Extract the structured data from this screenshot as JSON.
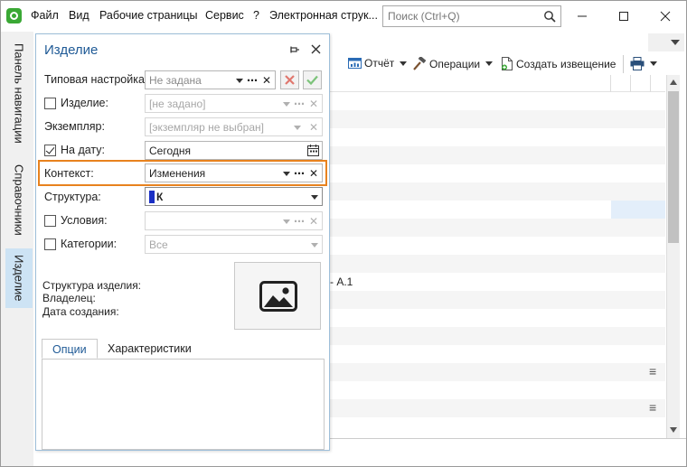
{
  "menu": [
    "Файл",
    "Вид",
    "Рабочие страницы",
    "Сервис",
    "?",
    "Электронная струк..."
  ],
  "search": {
    "placeholder": "Поиск (Ctrl+Q)"
  },
  "window_controls": {
    "minimize": "─",
    "maximize": "☐",
    "close": "✕"
  },
  "left_tabs": [
    {
      "label": "Панель навигации",
      "active": false
    },
    {
      "label": "Справочники",
      "active": false
    },
    {
      "label": "Изделие",
      "active": true
    }
  ],
  "toolbar": {
    "report_label": "Отчёт",
    "operations_label": "Операции",
    "create_notice_label": "Создать извещение"
  },
  "grid": {
    "row_text": "- А.1",
    "menu_glyph": "≡"
  },
  "panel": {
    "title": "Изделие",
    "pin_glyph": "⊸",
    "close_glyph": "✕",
    "fields": {
      "template": {
        "label": "Типовая настройка:",
        "value": "Не задана"
      },
      "product": {
        "label": "Изделие:",
        "value": "[не задано]",
        "checked": false
      },
      "instance": {
        "label": "Экземпляр:",
        "value": "[экземпляр не выбран]"
      },
      "on_date": {
        "label": "На дату:",
        "value": "Сегодня",
        "checked": true
      },
      "context": {
        "label": "Контекст:",
        "value": "Изменения"
      },
      "structure": {
        "label": "Структура:",
        "value": "К"
      },
      "conditions": {
        "label": "Условия:",
        "value": "",
        "checked": false
      },
      "categories": {
        "label": "Категории:",
        "value": "Все",
        "checked": false
      }
    },
    "info": {
      "structure_label": "Структура изделия:",
      "owner_label": "Владелец:",
      "created_label": "Дата создания:"
    },
    "tabs": [
      {
        "label": "Опции",
        "active": true
      },
      {
        "label": "Характеристики",
        "active": false
      }
    ]
  },
  "colors": {
    "accent": "#1f5a96",
    "highlight": "#e8821e",
    "green": "#3aa835",
    "cancel_red": "#d9534f"
  }
}
